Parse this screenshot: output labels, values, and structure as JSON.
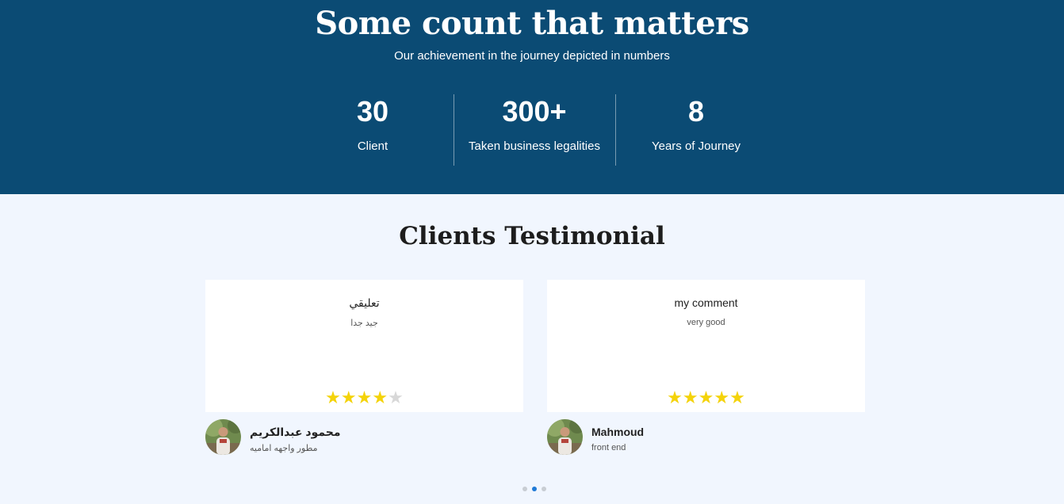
{
  "stats": {
    "title": "Some count that matters",
    "subtitle": "Our achievement in the journey depicted in numbers",
    "items": [
      {
        "value": "30",
        "label": "Client"
      },
      {
        "value": "300+",
        "label": "Taken business legalities"
      },
      {
        "value": "8",
        "label": "Years of Journey"
      }
    ]
  },
  "testimonials": {
    "title": "Clients Testimonial",
    "cards": [
      {
        "title": "تعليقي",
        "body": "جيد جدا",
        "rating": 4,
        "author_name": "محمود عبدالكريم",
        "author_role": "مطور واجهه اماميه"
      },
      {
        "title": "my comment",
        "body": "very good",
        "rating": 5,
        "author_name": "Mahmoud",
        "author_role": "front end"
      }
    ],
    "pagination": {
      "count": 3,
      "active": 2
    }
  },
  "colors": {
    "stats_bg": "#0b4b74",
    "page_bg": "#f1f6fe",
    "star_on": "#f4d30a",
    "star_off": "#d8d8d8",
    "dot_active": "#1f7ad6"
  },
  "icons": {
    "star": "star-icon",
    "avatar": "person-photo"
  }
}
